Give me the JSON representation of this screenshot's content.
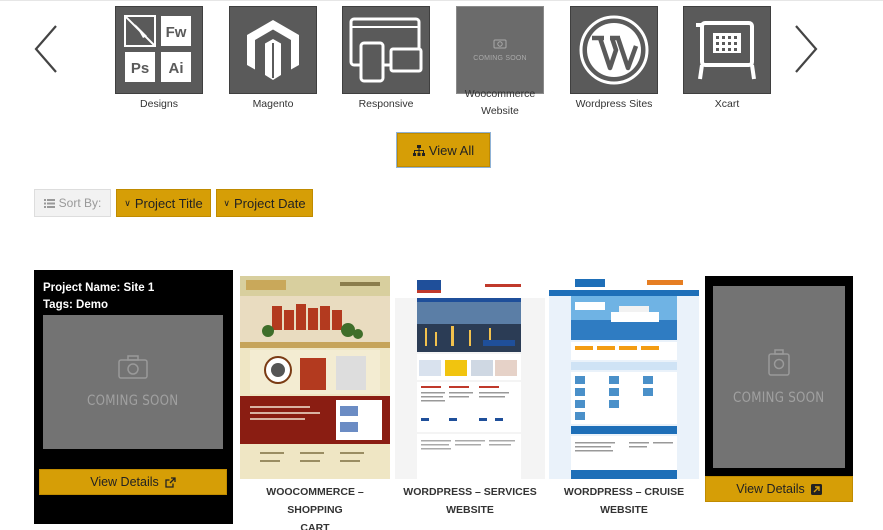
{
  "categories": [
    {
      "label": "Designs"
    },
    {
      "label": "Magento"
    },
    {
      "label": "Responsive"
    },
    {
      "label_line1": "Woocommerce",
      "label_line2": "Website",
      "coming_soon": "COMING SOON"
    },
    {
      "label": "Wordpress Sites"
    },
    {
      "label": "Xcart"
    }
  ],
  "design_icon_text": {
    "fw": "Fw",
    "ps": "Ps",
    "ai": "Ai"
  },
  "view_all_label": "View All",
  "sort": {
    "sort_by_label": "Sort By:",
    "title_label": "Project Title",
    "date_label": "Project Date"
  },
  "featured": {
    "name_line": "Project Name: Site 1",
    "tags_line": "Tags: Demo",
    "coming_soon": "COMING SOON",
    "details_label": "View Details"
  },
  "projects": [
    {
      "title_line1": "WOOCOMMERCE – SHOPPING",
      "title_line2": "CART"
    },
    {
      "title_line1": "WORDPRESS – SERVICES",
      "title_line2": "WEBSITE"
    },
    {
      "title_line1": "WORDPRESS – CRUISE",
      "title_line2": "WEBSITE"
    }
  ],
  "last_card": {
    "coming_soon": "COMING SOON",
    "details_label": "View Details"
  },
  "colors": {
    "accent": "#d69e06",
    "tile": "#5a5a5a",
    "placeholder": "#737373"
  }
}
